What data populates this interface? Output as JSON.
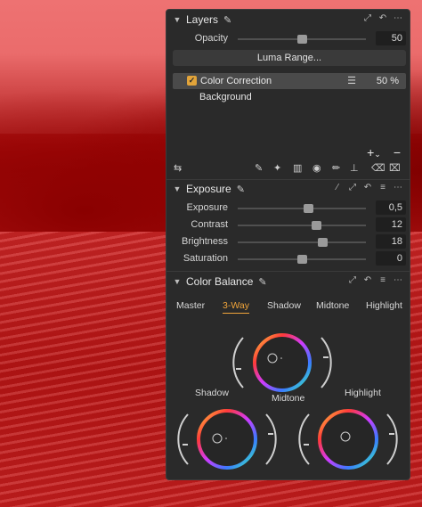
{
  "layers": {
    "title": "Layers",
    "opacity_label": "Opacity",
    "opacity_value": "50",
    "opacity_fraction": 0.5,
    "luma_range_label": "Luma Range...",
    "items": [
      {
        "name": "Color Correction",
        "opacity": "50 %",
        "checked": true,
        "selected": true
      },
      {
        "name": "Background",
        "opacity": "",
        "checked": false,
        "selected": false
      }
    ],
    "add_glyph": "+",
    "add_chevron": "⌄",
    "remove_glyph": "−"
  },
  "exposure": {
    "title": "Exposure",
    "sliders": [
      {
        "label": "Exposure",
        "value": "0,5",
        "fraction": 0.55
      },
      {
        "label": "Contrast",
        "value": "12",
        "fraction": 0.61
      },
      {
        "label": "Brightness",
        "value": "18",
        "fraction": 0.66
      },
      {
        "label": "Saturation",
        "value": "0",
        "fraction": 0.5
      }
    ]
  },
  "color_balance": {
    "title": "Color Balance",
    "tabs": [
      "Master",
      "3-Way",
      "Shadow",
      "Midtone",
      "Highlight"
    ],
    "active_tab": "3-Way",
    "wheels": {
      "midtone": "Midtone",
      "shadow": "Shadow",
      "highlight": "Highlight"
    }
  },
  "colors": {
    "accent": "#f0a43a",
    "panel_bg": "#2a2a2a",
    "field_bg": "#1f1f1f"
  },
  "icons": {
    "collapse": "chevron-down-icon",
    "edit": "pencil-icon",
    "menu": "hamburger-icon",
    "more": "ellipsis-icon"
  }
}
